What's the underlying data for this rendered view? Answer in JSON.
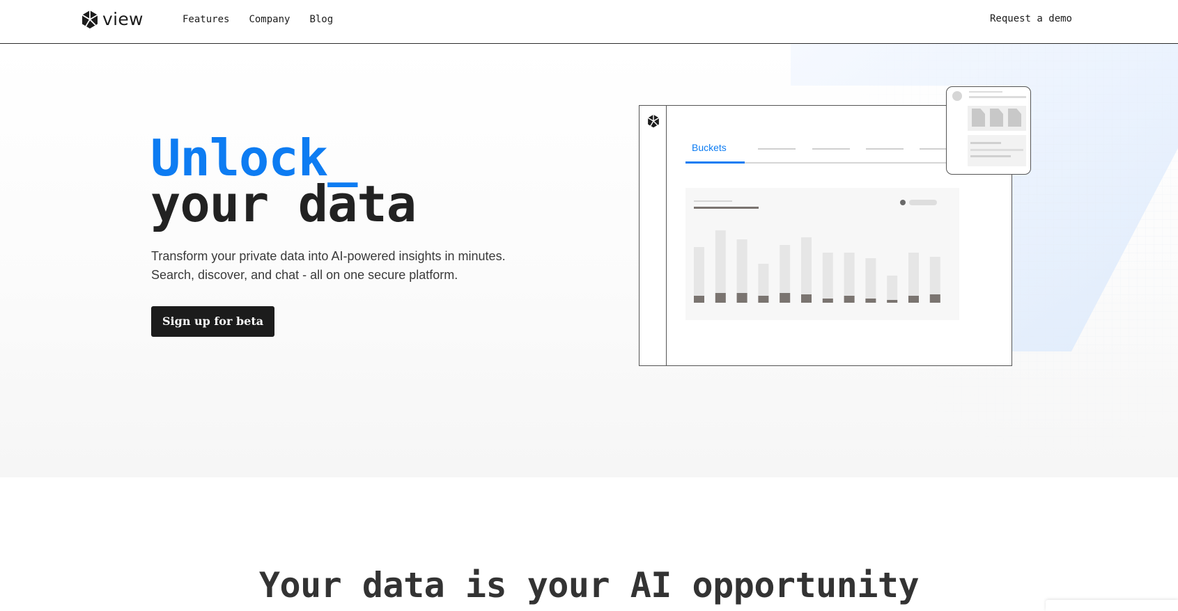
{
  "header": {
    "logo_text": "view",
    "nav": [
      "Features",
      "Company",
      "Blog"
    ],
    "request_demo": "Request a demo"
  },
  "hero": {
    "title_line1": "Unlock_",
    "title_line2": "your data",
    "subtitle_line1": "Transform your private data into AI-powered insights in minutes.",
    "subtitle_line2": "Search, discover, and chat - all on one secure platform.",
    "cta_label": "Sign up for beta",
    "accent_color": "#0d7cf2"
  },
  "illustration": {
    "active_tab": "Buckets",
    "bar_chart": {
      "type": "bar",
      "series": [
        {
          "values": [
            80,
            104,
            91,
            56,
            83,
            94,
            72,
            72,
            64,
            39,
            72,
            66
          ]
        },
        {
          "values": [
            10,
            14,
            14,
            10,
            14,
            12,
            6,
            10,
            6,
            4,
            10,
            12
          ]
        }
      ],
      "colors": [
        "#e6e6e6",
        "#7a7470"
      ]
    }
  },
  "section2": {
    "title": "Your data is your AI opportunity"
  }
}
